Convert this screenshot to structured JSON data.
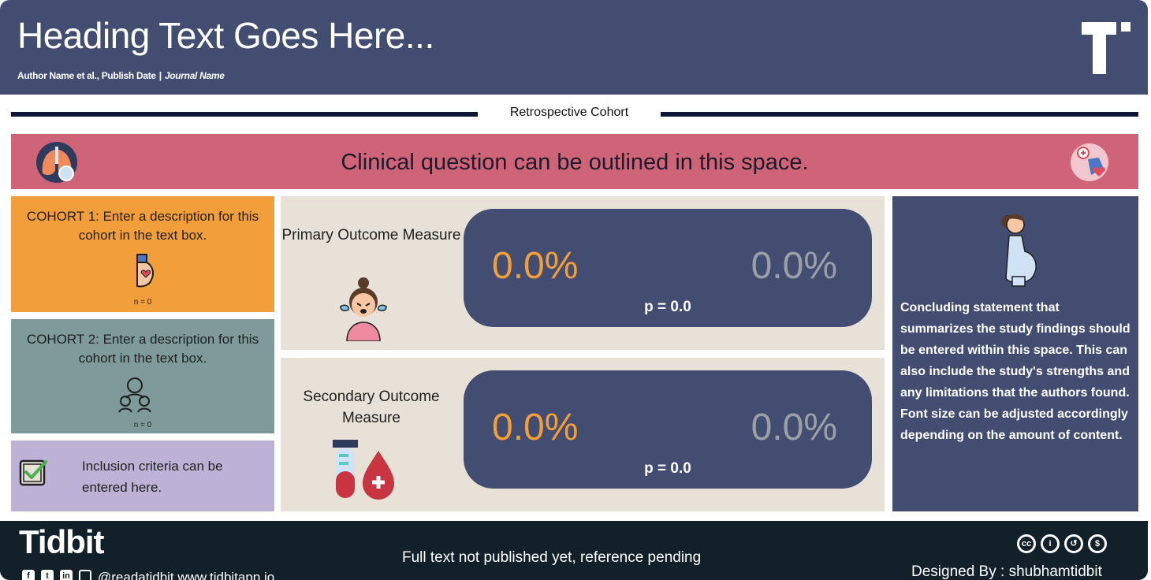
{
  "header": {
    "title": "Heading Text Goes Here...",
    "byline_author": "Author Name et al., Publish Date",
    "byline_separator": "|",
    "byline_journal": "Journal Name"
  },
  "study_type": "Retrospective Cohort",
  "clinical_question": "Clinical question can be outlined in this space.",
  "cohorts": [
    {
      "description": "COHORT 1: Enter a description for this cohort in the text box.",
      "n": "n = 0",
      "icon": "pregnant-belly-icon"
    },
    {
      "description": "COHORT 2: Enter a description for this cohort in the text box.",
      "n": "n = 0",
      "icon": "family-group-icon"
    }
  ],
  "inclusion": {
    "text": "Inclusion criteria can be entered here.",
    "icon": "checklist-icon"
  },
  "outcomes": [
    {
      "label": "Primary Outcome Measure",
      "value_1": "0.0%",
      "value_2": "0.0%",
      "p_value": "p = 0.0",
      "icon": "crying-woman-icon"
    },
    {
      "label": "Secondary Outcome Measure",
      "value_1": "0.0%",
      "value_2": "0.0%",
      "p_value": "p = 0.0",
      "icon": "blood-test-icon"
    }
  ],
  "conclusion": {
    "lead": "Concluding statement",
    "text": " that summarizes the study findings should be entered within this space. This can also include the study's strengths and any limitations that the authors found. Font size can be adjusted accordingly depending on the amount of content.",
    "icon": "pregnant-woman-icon"
  },
  "footer": {
    "brand": "Tidbit",
    "socials": "@readatidbit  www.tidbitapp.io",
    "note": "Full text not published yet, reference pending",
    "designer": "Designed By : shubhamtidbit"
  },
  "colors": {
    "header": "#434d72",
    "question": "#cf6478",
    "cohort_1": "#f29e3a",
    "cohort_2": "#7f9a9a",
    "inclusion": "#bdb1d6",
    "outcome_panel": "#e7e1d7",
    "footer": "#12202a"
  }
}
